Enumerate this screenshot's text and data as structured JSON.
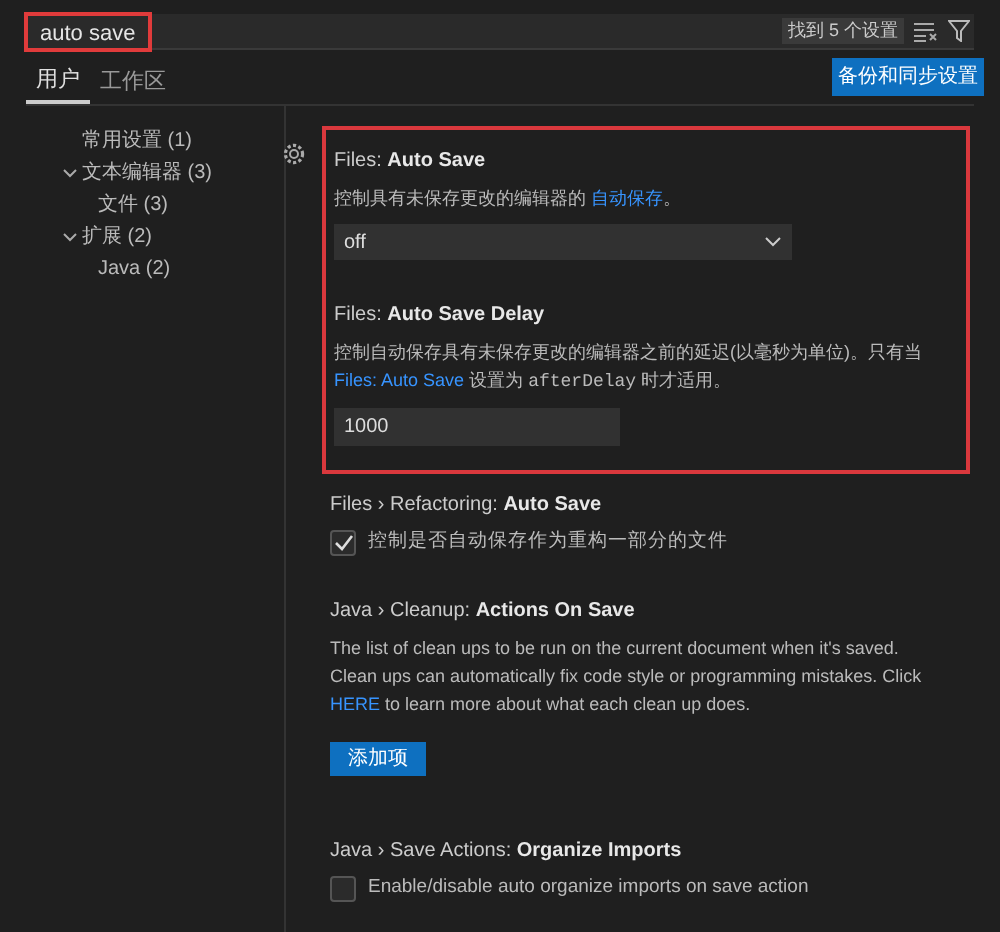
{
  "search": {
    "value": "auto save",
    "highlighted": true,
    "result_count": "找到 5 个设置"
  },
  "tabs": [
    {
      "label": "用户",
      "selected": true
    },
    {
      "label": "工作区",
      "selected": false
    }
  ],
  "sync_button": "备份和同步设置",
  "tree": [
    {
      "label": "常用设置 (1)"
    },
    {
      "label": "文本编辑器 (3)",
      "expanded": true,
      "children": [
        {
          "label": "文件 (3)"
        }
      ]
    },
    {
      "label": "扩展 (2)",
      "expanded": true,
      "children": [
        {
          "label": "Java (2)"
        }
      ]
    }
  ],
  "settings": [
    {
      "kind": "dropdown",
      "highlighted": true,
      "gear": true,
      "category": "Files: ",
      "name": "Auto Save",
      "description": [
        {
          "kind": "text",
          "text": "控制具有未保存更改的编辑器的 "
        },
        {
          "kind": "link",
          "text": "自动保存"
        },
        {
          "kind": "text",
          "text": "。"
        }
      ],
      "value": "off"
    },
    {
      "kind": "number",
      "highlighted": true,
      "gear": false,
      "category": "Files: ",
      "name": "Auto Save Delay",
      "description": [
        {
          "kind": "text",
          "text": "控制自动保存具有未保存更改的编辑器之前的延迟(以毫秒为单位)。只有当 "
        },
        {
          "kind": "link",
          "text": "Files: Auto Save"
        },
        {
          "kind": "text",
          "text": " 设置为 "
        },
        {
          "kind": "code",
          "text": "afterDelay"
        },
        {
          "kind": "text",
          "text": " 时才适用。"
        }
      ],
      "value": "1000"
    },
    {
      "kind": "checkbox",
      "highlighted": false,
      "gear": false,
      "category": "Files › Refactoring: ",
      "name": "Auto Save",
      "checked": true,
      "label": "控制是否自动保存作为重构一部分的文件"
    },
    {
      "kind": "list",
      "highlighted": false,
      "gear": false,
      "category": "Java › Cleanup: ",
      "name": "Actions On Save",
      "description": [
        {
          "kind": "text",
          "text": "The list of clean ups to be run on the current document when it's saved. Clean ups can automatically fix code style or programming mistakes. Click "
        },
        {
          "kind": "link",
          "text": "HERE"
        },
        {
          "kind": "text",
          "text": " to learn more about what each clean up does."
        }
      ],
      "button": "添加项"
    },
    {
      "kind": "checkbox",
      "highlighted": false,
      "gear": false,
      "category": "Java › Save Actions: ",
      "name": "Organize Imports",
      "checked": false,
      "label": "Enable/disable auto organize imports on save action"
    }
  ]
}
